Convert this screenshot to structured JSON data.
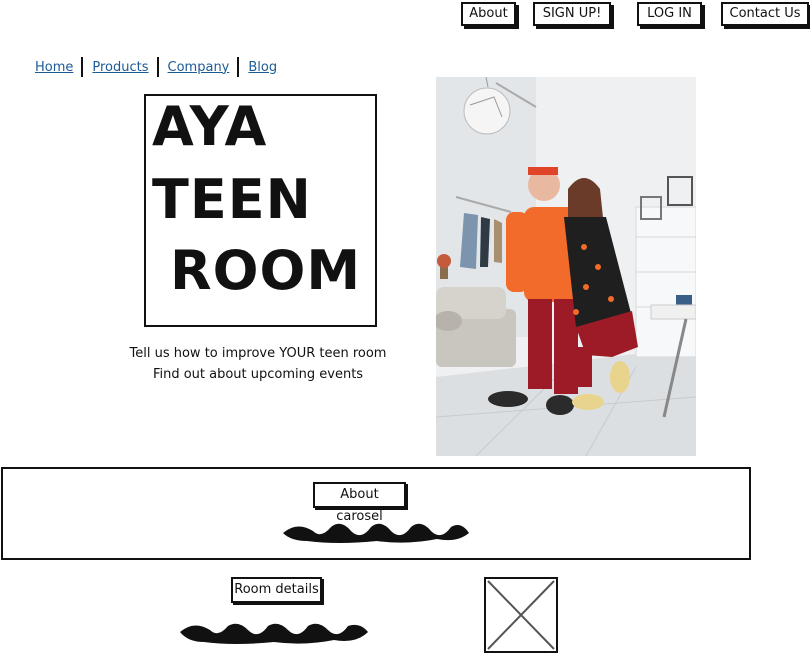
{
  "topnav": {
    "about": "About",
    "signup": "SIGN UP!",
    "login": "LOG IN",
    "contact": "Contact Us"
  },
  "nav": {
    "items": [
      "Home",
      "Products",
      "Company",
      "Blog"
    ]
  },
  "hero": {
    "title_lines": [
      "AYA",
      "TEEN",
      "ROOM"
    ],
    "tagline_1": "Tell us how to improve YOUR teen room",
    "tagline_2": "Find out about upcoming events"
  },
  "carousel": {
    "label": "About carosel"
  },
  "room": {
    "label": "Room details"
  },
  "colors": {
    "link": "#1c5b96",
    "shirt_orange": "#f26b2a",
    "pants_red": "#9c1b26"
  }
}
